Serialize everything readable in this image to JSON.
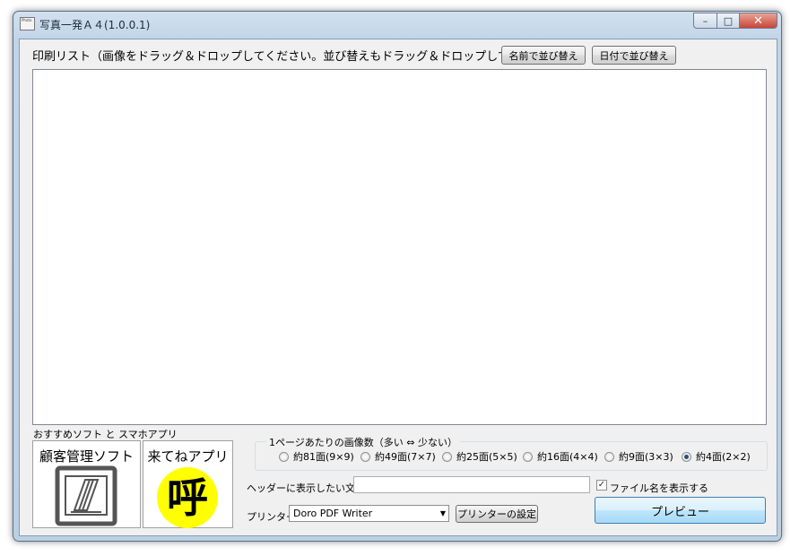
{
  "window": {
    "title": "写真一発Ａ４(1.0.0.1)",
    "icon_text": "Photo",
    "close_glyph": "✕",
    "minimize_glyph": "–",
    "maximize_glyph": "□"
  },
  "print_list": {
    "label": "印刷リスト（画像をドラッグ＆ドロップしてください。並び替えもドラッグ＆ドロップしてください。）",
    "sort_by_name": "名前で並び替え",
    "sort_by_date": "日付で並び替え"
  },
  "recommended": {
    "label": "おすすめソフト と スマホアプリ",
    "customer_app": "顧客管理ソフト",
    "call_app": "来てねアプリ",
    "call_glyph": "呼"
  },
  "images_per_page": {
    "label": "1ページあたりの画像数（多い ⇔ 少ない）",
    "options": [
      {
        "label": "約81面(9×9)",
        "selected": false
      },
      {
        "label": "約49面(7×7)",
        "selected": false
      },
      {
        "label": "約25面(5×5)",
        "selected": false
      },
      {
        "label": "約16面(4×4)",
        "selected": false
      },
      {
        "label": "約9面(3×3)",
        "selected": false
      },
      {
        "label": "約4面(2×2)",
        "selected": true
      }
    ]
  },
  "header": {
    "label": "ヘッダーに表示したい文言",
    "value": "",
    "show_filename_label": "ファイル名を表示する",
    "show_filename_checked": true
  },
  "printer": {
    "label": "プリンター",
    "selected": "Doro PDF Writer",
    "settings_button": "プリンターの設定"
  },
  "preview_button": "プレビュー",
  "colors": {
    "call_circle": "#ffff00",
    "customer_icon_border": "#555555"
  }
}
